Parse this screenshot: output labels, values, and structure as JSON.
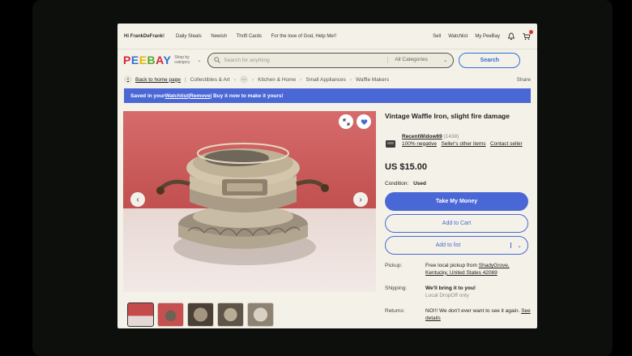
{
  "topbar": {
    "user": "Hi FrankDeFrank!",
    "nav": [
      "Daily Steals",
      "Newish",
      "Thrift Cards",
      "For the love of God, Help Me!!"
    ],
    "sell": "Sell",
    "watchlist": "Watchlist",
    "mypeebay": "My PeeBay"
  },
  "header": {
    "logo": [
      "P",
      "E",
      "E",
      "B",
      "A",
      "Y"
    ],
    "shop_by_category": "Shop by category",
    "search_placeholder": "Search for anything",
    "all_categories": "All Categories",
    "search_button": "Search"
  },
  "breadcrumb": {
    "back": "Back to home page",
    "items": [
      "Collectibles & Art",
      "Kitchen & Home",
      "Small Appliances",
      "Waffle Makers"
    ],
    "share": "Share"
  },
  "banner": {
    "prefix": "Saved in your ",
    "watchlist": "Watchlist",
    "sep1": " | ",
    "remove": "Remove",
    "suffix": " | Buy it now to make it yours!"
  },
  "item": {
    "title": "Vintage Waffle Iron, slight fire damage",
    "seller_name": "RecentWidow69",
    "seller_score": "(1438)",
    "feedback": "100% negative",
    "other_items": "Seller's other items",
    "contact": "Contact seller",
    "price": "US $15.00",
    "condition_label": "Condition:",
    "condition_value": "Used",
    "buy_button": "Take My Money",
    "cart_button": "Add to Cart",
    "watch_button": "Add to list"
  },
  "details": {
    "pickup_label": "Pickup:",
    "pickup_text": "Free local pickup from ",
    "pickup_place": "ShadyGrove, Kentucky, United States 42069",
    "shipping_label": "Shipping:",
    "shipping_text": "We'll bring it to you!",
    "shipping_sub": "Local DropOff only",
    "returns_label": "Returns:",
    "returns_text": "NO!!! We don't ever want to see it again. ",
    "returns_link": "See details"
  },
  "colors": {
    "accent": "#4a67d6",
    "banner": "#4a67d6",
    "screen_bg": "#f4f2e8"
  }
}
